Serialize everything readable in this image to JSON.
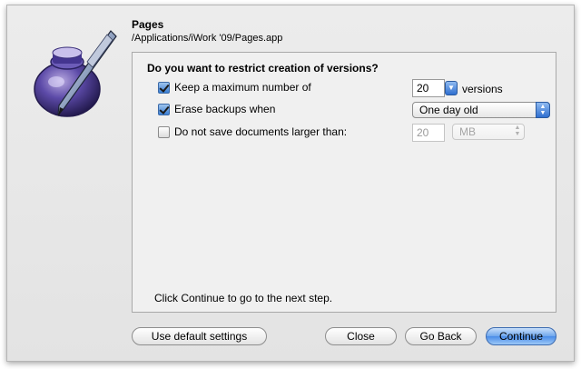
{
  "app": {
    "name": "Pages",
    "path": "/Applications/iWork '09/Pages.app"
  },
  "panel": {
    "question": "Do you want to restrict creation of versions?",
    "options": {
      "max_versions": {
        "label": "Keep a maximum number of",
        "checked": true,
        "value": "20",
        "suffix": "versions"
      },
      "erase_backups": {
        "label": "Erase backups when",
        "checked": true,
        "selected": "One day old"
      },
      "size_limit": {
        "label": "Do not save documents larger than:",
        "checked": false,
        "value": "20",
        "unit": "MB"
      }
    },
    "footer_text": "Click Continue to go to the next step."
  },
  "buttons": {
    "use_default": "Use default settings",
    "close": "Close",
    "go_back": "Go Back",
    "continue": "Continue"
  },
  "icons": {
    "app_icon": "pages-app-icon",
    "stepper": "stepper-arrows-icon",
    "popup": "popup-arrows-icon"
  },
  "colors": {
    "accent": "#3a7fd6",
    "window_bg": "#e9e9e9",
    "panel_bg": "#f0f0f0"
  }
}
